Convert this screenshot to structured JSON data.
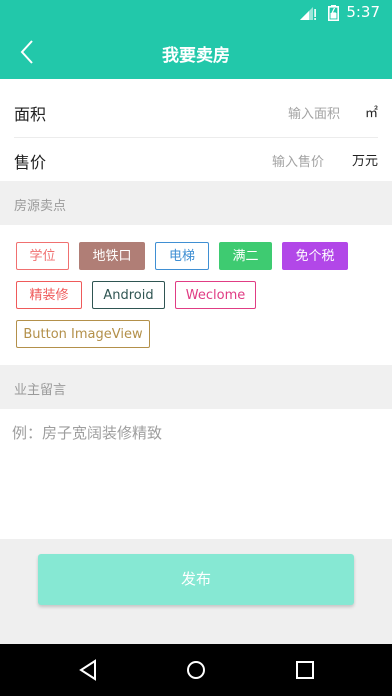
{
  "status_bar": {
    "time": "5:37",
    "icons": [
      "signal-icon",
      "battery-icon"
    ]
  },
  "app_bar": {
    "title": "我要卖房",
    "back_icon": "chevron-left-icon",
    "color": "#22c8aa"
  },
  "form": {
    "area": {
      "label": "面积",
      "placeholder": "输入面积",
      "unit": "㎡"
    },
    "price": {
      "label": "售价",
      "placeholder": "输入售价",
      "unit": "万元"
    }
  },
  "selling_points": {
    "header": "房源卖点",
    "tags": [
      {
        "label": "学位",
        "color": "#f07070",
        "filled": false
      },
      {
        "label": "地铁口",
        "color": "#b07e76",
        "filled": true
      },
      {
        "label": "电梯",
        "color": "#3f8fd3",
        "filled": false
      },
      {
        "label": "满二",
        "color": "#3ecb71",
        "filled": true
      },
      {
        "label": "免个税",
        "color": "#b247e8",
        "filled": true
      },
      {
        "label": "精装修",
        "color": "#ef5a5a",
        "filled": false
      },
      {
        "label": "Android",
        "color": "#2f5552",
        "filled": false
      },
      {
        "label": "Weclome",
        "color": "#e03c84",
        "filled": false
      },
      {
        "label": "Button ImageView",
        "color": "#b3904a",
        "filled": false
      }
    ]
  },
  "owner_message": {
    "header": "业主留言",
    "placeholder": "例：房子宽阔装修精致"
  },
  "publish_button": "发布",
  "nav_bar": {
    "icons": [
      "back-triangle-icon",
      "home-circle-icon",
      "recents-square-icon"
    ]
  }
}
